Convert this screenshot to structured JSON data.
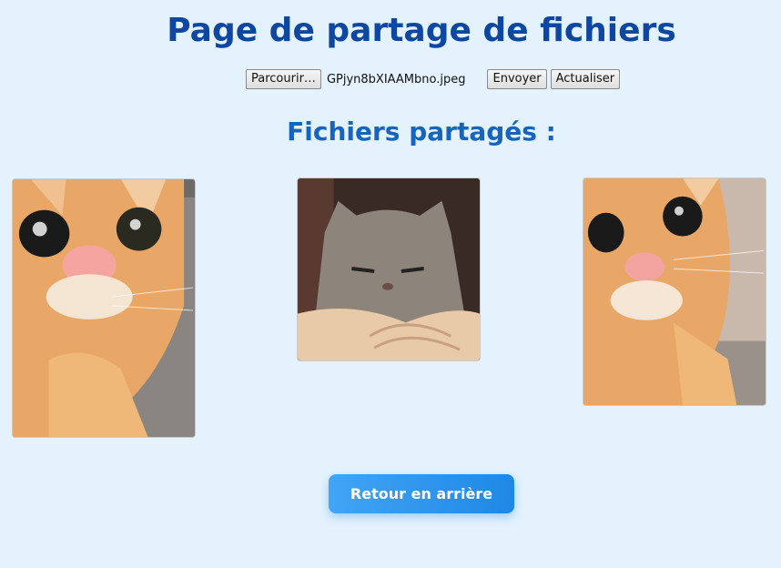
{
  "page": {
    "title": "Page de partage de fichiers",
    "subtitle": "Fichiers partagés :"
  },
  "upload": {
    "browse_label": "Parcourir…",
    "selected_file": "GPjyn8bXIAAMbno.jpeg",
    "send_label": "Envoyer",
    "refresh_label": "Actualiser"
  },
  "files": [
    {
      "alt": "orange cat close-up"
    },
    {
      "alt": "grey cat grumpy"
    },
    {
      "alt": "orange cat reaching"
    }
  ],
  "back_button": "Retour en arrière"
}
